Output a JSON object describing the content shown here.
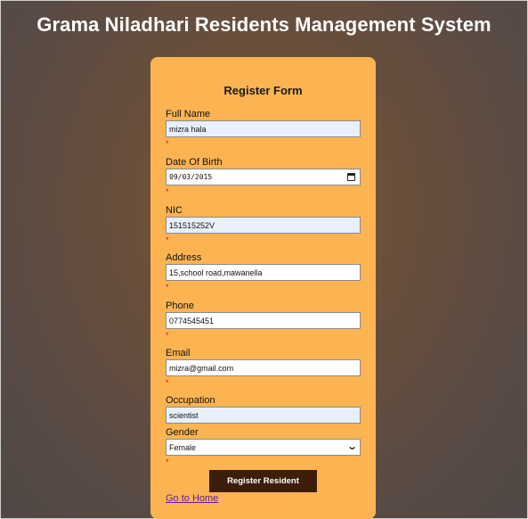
{
  "app": {
    "title": "Grama Niladhari Residents Management System"
  },
  "form": {
    "title": "Register Form",
    "required_marker": "*",
    "fields": {
      "full_name": {
        "label": "Full Name",
        "value": "mizra hala"
      },
      "dob": {
        "label": "Date Of Birth",
        "value": "09/03/2015",
        "icon": "calendar-icon"
      },
      "nic": {
        "label": "NIC",
        "value": "151515252V"
      },
      "address": {
        "label": "Address",
        "value": "15,school road,mawanella"
      },
      "phone": {
        "label": "Phone",
        "value": "0774545451"
      },
      "email": {
        "label": "Email",
        "value": "mizra@gmail.com"
      },
      "occupation": {
        "label": "Occupation",
        "value": "scientist"
      },
      "gender": {
        "label": "Gender",
        "value": "Female",
        "icon": "chevron-down-icon"
      }
    },
    "submit_label": "Register Resident",
    "home_link_label": "Go to Home"
  },
  "colors": {
    "card_background": "#fcb453",
    "button_background": "#3d1e0a",
    "autofill_background": "#e8f0fe",
    "required_marker": "#e01010",
    "link": "#5b1e9b"
  }
}
